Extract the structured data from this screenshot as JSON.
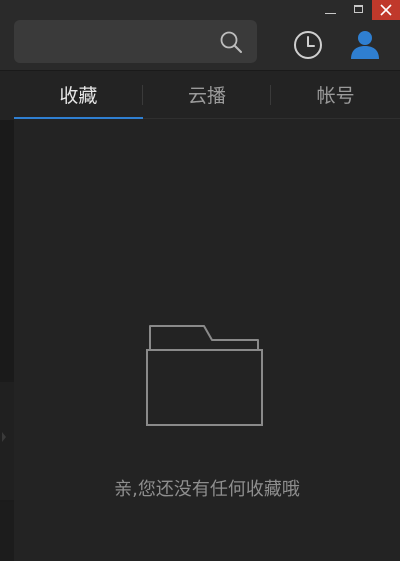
{
  "window": {
    "minimize_icon": "minimize-icon",
    "maximize_icon": "maximize-icon",
    "close_icon": "close-icon",
    "close_color": "#c0392b"
  },
  "header": {
    "search": {
      "value": "",
      "placeholder": "",
      "icon": "search-icon"
    },
    "history_icon": "clock-icon",
    "account_icon": "user-icon",
    "account_icon_color": "#2f7fd1"
  },
  "tabs": [
    {
      "label": "收藏",
      "active": true
    },
    {
      "label": "云播",
      "active": false
    },
    {
      "label": "帐号",
      "active": false
    }
  ],
  "accent_color": "#2f7fd1",
  "empty_state": {
    "icon": "folder-icon",
    "message": "亲,您还没有任何收藏哦"
  }
}
